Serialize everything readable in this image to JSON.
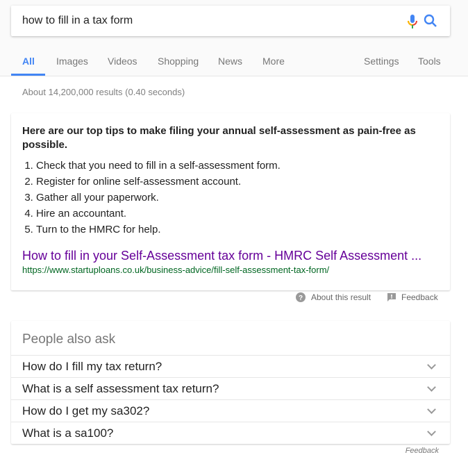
{
  "search": {
    "query": "how to fill in a tax form",
    "icons": [
      "mic-icon",
      "search-icon"
    ]
  },
  "tabs": [
    {
      "label": "All",
      "active": true
    },
    {
      "label": "Images"
    },
    {
      "label": "Videos"
    },
    {
      "label": "Shopping"
    },
    {
      "label": "News"
    },
    {
      "label": "More"
    }
  ],
  "tools": {
    "settings": "Settings",
    "tools": "Tools"
  },
  "stats": "About 14,200,000 results (0.40 seconds)",
  "snippet": {
    "heading": "Here are our top tips to make filing your annual self-assessment as pain-free as possible.",
    "items": [
      "Check that you need to fill in a self-assessment form.",
      "Register for online self-assessment account.",
      "Gather all your paperwork.",
      "Hire an accountant.",
      "Turn to the HMRC for help."
    ],
    "link": "How to fill in your Self-Assessment tax form - HMRC Self Assessment ...",
    "url": "https://www.startuploans.co.uk/business-advice/fill-self-assessment-tax-form/"
  },
  "meta": {
    "about": "About this result",
    "feedback": "Feedback"
  },
  "paa": {
    "title": "People also ask",
    "questions": [
      "How do I fill my tax return?",
      "What is a self assessment tax return?",
      "How do I get my sa302?",
      "What is a sa100?"
    ],
    "feedback": "Feedback"
  },
  "colors": {
    "accent": "#4285f4",
    "link": "#660099",
    "url": "#006621"
  }
}
